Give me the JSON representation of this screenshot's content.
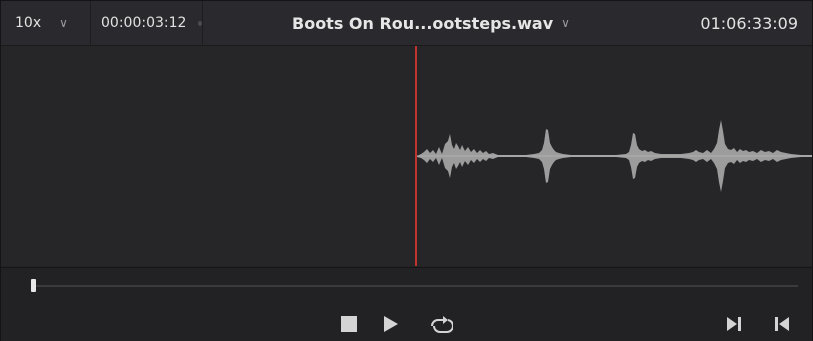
{
  "header": {
    "zoom": "10x",
    "zoom_icon": "chevron-down-icon",
    "timecode_left": "00:00:03:12",
    "clip_name": "Boots On Rou...ootsteps.wav",
    "clip_icon": "chevron-down-icon",
    "timecode_right": "01:06:33:09"
  },
  "waveform": {
    "color": "#9c9c9c",
    "playhead_color": "#c0322e"
  },
  "transport": {
    "scrub_position": 0.0,
    "controls": [
      "stop-icon",
      "play-icon",
      "loop-icon",
      "next-frame-icon",
      "previous-frame-icon"
    ]
  },
  "colors": {
    "header_bg": "#2a2a2e",
    "panel_bg": "#262629",
    "text": "#e2e2e2"
  }
}
